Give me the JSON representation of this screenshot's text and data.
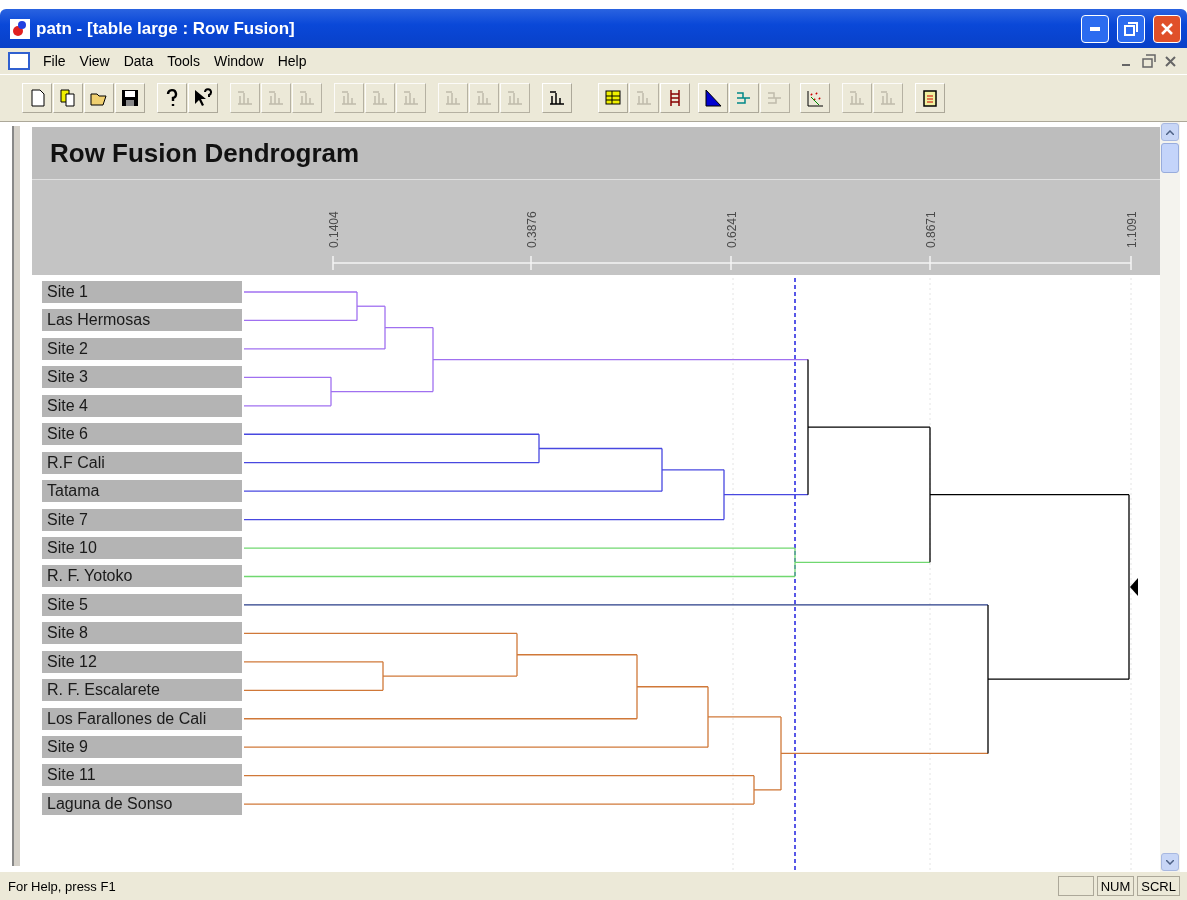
{
  "window": {
    "title": "patn - [table large : Row Fusion]"
  },
  "menu": [
    "File",
    "View",
    "Data",
    "Tools",
    "Window",
    "Help"
  ],
  "toolbar": [
    {
      "disabled": false
    },
    {
      "disabled": false
    },
    {
      "disabled": false
    },
    {
      "disabled": false
    },
    {
      "disabled": false
    },
    {
      "disabled": false
    },
    {
      "disabled": true
    },
    {
      "disabled": true
    },
    {
      "disabled": true
    },
    {
      "disabled": true
    },
    {
      "disabled": true
    },
    {
      "disabled": true
    },
    {
      "disabled": true
    },
    {
      "disabled": true
    },
    {
      "disabled": true
    },
    {
      "disabled": false
    },
    {
      "disabled": false
    },
    {
      "disabled": true
    },
    {
      "disabled": false
    },
    {
      "disabled": false
    },
    {
      "disabled": false
    },
    {
      "disabled": true
    },
    {
      "disabled": false
    },
    {
      "disabled": true
    },
    {
      "disabled": true
    },
    {
      "disabled": false
    }
  ],
  "dendrogram": {
    "title": "Row Fusion Dendrogram",
    "axis_labels": [
      "0.1404",
      "0.3876",
      "0.6241",
      "0.8671",
      "1.1091"
    ],
    "rows": [
      {
        "label": "Site 1"
      },
      {
        "label": "Las Hermosas"
      },
      {
        "label": "Site 2"
      },
      {
        "label": "Site 3"
      },
      {
        "label": "Site 4"
      },
      {
        "label": "Site 6"
      },
      {
        "label": "R.F Cali"
      },
      {
        "label": "Tatama"
      },
      {
        "label": "Site 7"
      },
      {
        "label": "Site 10"
      },
      {
        "label": "R. F.  Yotoko"
      },
      {
        "label": "Site 5"
      },
      {
        "label": "Site 8"
      },
      {
        "label": "Site 12"
      },
      {
        "label": "R. F.  Escalarete"
      },
      {
        "label": "Los Farallones de Cali"
      },
      {
        "label": "Site 9"
      },
      {
        "label": "Site 11"
      },
      {
        "label": "Laguna de Sonso"
      }
    ]
  },
  "status_bar": {
    "help": "For Help, press F1",
    "indicators": [
      "NUM",
      "SCRL"
    ]
  }
}
